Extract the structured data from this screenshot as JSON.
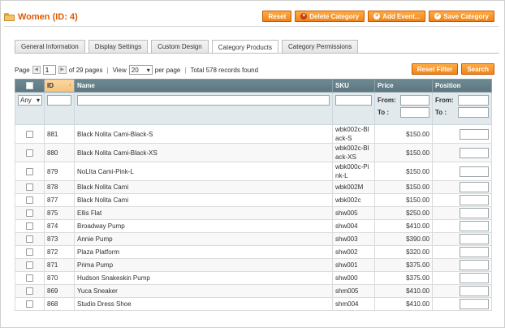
{
  "header": {
    "title": "Women (ID: 4)"
  },
  "actions": {
    "reset": "Reset",
    "delete": "Delete Category",
    "add_event": "Add Event...",
    "save": "Save Category"
  },
  "tabs": [
    {
      "label": "General Information"
    },
    {
      "label": "Display Settings"
    },
    {
      "label": "Custom Design"
    },
    {
      "label": "Category Products",
      "active": true
    },
    {
      "label": "Category Permissions"
    }
  ],
  "pager": {
    "page_label": "Page",
    "page_value": "1",
    "of_pages": "of 29 pages",
    "view_label": "View",
    "per_page_value": "20",
    "per_page_label": "per page",
    "total": "Total 578 records found",
    "reset_filter": "Reset Filter",
    "search": "Search"
  },
  "grid": {
    "columns": {
      "id": "ID",
      "name": "Name",
      "sku": "SKU",
      "price": "Price",
      "position": "Position"
    },
    "filters": {
      "any": "Any",
      "from": "From:",
      "to": "To :"
    },
    "rows": [
      {
        "id": "881",
        "name": "Black Nolita Cami-Black-S",
        "sku": "wbk002c-Black-S",
        "price": "$150.00"
      },
      {
        "id": "880",
        "name": "Black Nolita Cami-Black-XS",
        "sku": "wbk002c-Black-XS",
        "price": "$150.00"
      },
      {
        "id": "879",
        "name": "NoLIta Cami-Pink-L",
        "sku": "wbk000c-Pink-L",
        "price": "$150.00"
      },
      {
        "id": "878",
        "name": "Black Nolita Cami",
        "sku": "wbk002M",
        "price": "$150.00"
      },
      {
        "id": "877",
        "name": "Black Nolita Cami",
        "sku": "wbk002c",
        "price": "$150.00"
      },
      {
        "id": "875",
        "name": "Ellis Flat",
        "sku": "shw005",
        "price": "$250.00"
      },
      {
        "id": "874",
        "name": "Broadway Pump",
        "sku": "shw004",
        "price": "$410.00"
      },
      {
        "id": "873",
        "name": "Annie Pump",
        "sku": "shw003",
        "price": "$390.00"
      },
      {
        "id": "872",
        "name": "Plaza Platform",
        "sku": "shw002",
        "price": "$320.00"
      },
      {
        "id": "871",
        "name": "Prima Pump",
        "sku": "shw001",
        "price": "$375.00"
      },
      {
        "id": "870",
        "name": "Hudson Snakeskin Pump",
        "sku": "shw000",
        "price": "$375.00"
      },
      {
        "id": "869",
        "name": "Yuca Sneaker",
        "sku": "shm005",
        "price": "$410.00"
      },
      {
        "id": "868",
        "name": "Studio Dress Shoe",
        "sku": "shm004",
        "price": "$410.00"
      }
    ]
  }
}
